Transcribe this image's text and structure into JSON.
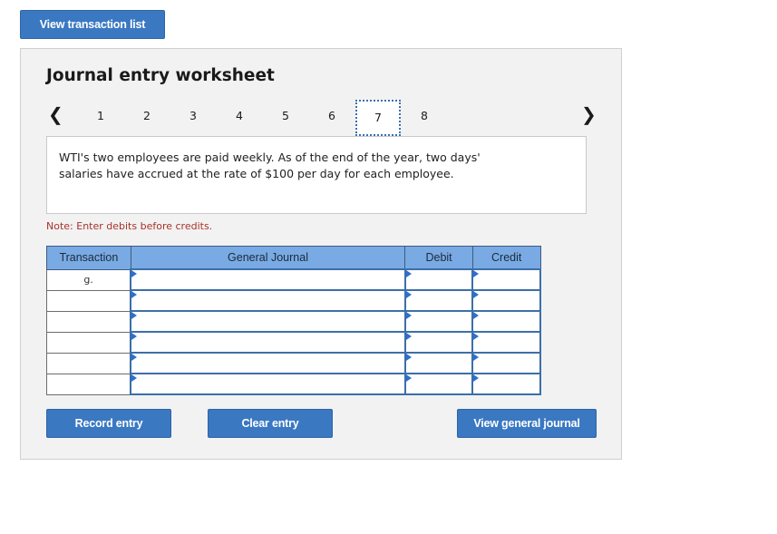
{
  "top_button": {
    "label": "View transaction list"
  },
  "worksheet": {
    "title": "Journal entry worksheet",
    "pages": [
      "1",
      "2",
      "3",
      "4",
      "5",
      "6",
      "7",
      "8"
    ],
    "active_page": "7",
    "description_line1": "WTI's two employees are paid weekly. As of the end of the year, two days'",
    "description_line2": "salaries have accrued at the rate of $100 per day for each employee.",
    "note": "Note: Enter debits before credits."
  },
  "table": {
    "headers": {
      "transaction": "Transaction",
      "journal": "General Journal",
      "debit": "Debit",
      "credit": "Credit"
    },
    "rows": [
      {
        "transaction": "g.",
        "journal": "",
        "debit": "",
        "credit": ""
      },
      {
        "transaction": "",
        "journal": "",
        "debit": "",
        "credit": ""
      },
      {
        "transaction": "",
        "journal": "",
        "debit": "",
        "credit": ""
      },
      {
        "transaction": "",
        "journal": "",
        "debit": "",
        "credit": ""
      },
      {
        "transaction": "",
        "journal": "",
        "debit": "",
        "credit": ""
      },
      {
        "transaction": "",
        "journal": "",
        "debit": "",
        "credit": ""
      }
    ]
  },
  "actions": {
    "record": "Record entry",
    "clear": "Clear entry",
    "view_journal": "View general journal"
  },
  "colors": {
    "button": "#3a78c2",
    "header": "#7aaae3",
    "note": "#a8322a",
    "panel": "#f2f2f2"
  },
  "icons": {
    "prev": "chevron-left-icon",
    "next": "chevron-right-icon",
    "cell_marker": "triangle-marker-icon"
  }
}
